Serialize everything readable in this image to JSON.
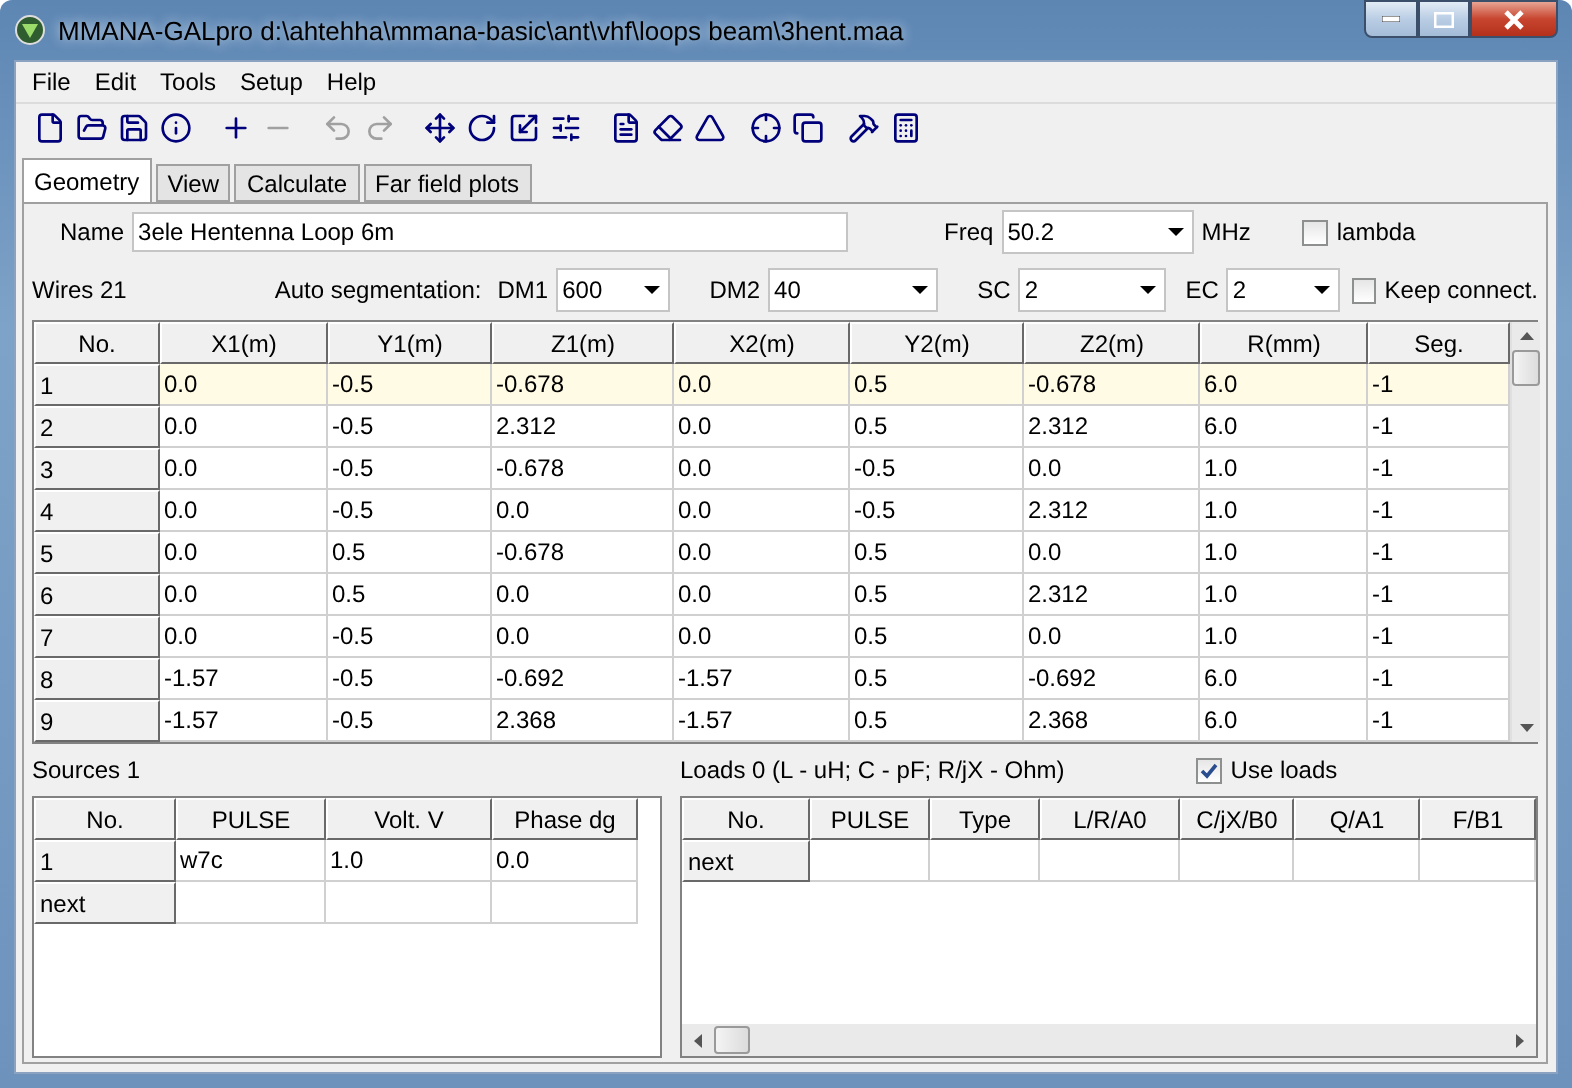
{
  "window": {
    "title": "MMANA-GALpro d:\\ahtehha\\mmana-basic\\ant\\vhf\\loops beam\\3hent.maa"
  },
  "menu": [
    "File",
    "Edit",
    "Tools",
    "Setup",
    "Help"
  ],
  "toolbar": [
    {
      "kind": "new",
      "disabled": false
    },
    {
      "kind": "open",
      "disabled": false
    },
    {
      "kind": "save",
      "disabled": false
    },
    {
      "kind": "info",
      "disabled": false
    },
    {
      "kind": "add",
      "disabled": false
    },
    {
      "kind": "remove",
      "disabled": true
    },
    {
      "kind": "undo",
      "disabled": true
    },
    {
      "kind": "redo",
      "disabled": true
    },
    {
      "kind": "move",
      "disabled": false
    },
    {
      "kind": "rotate",
      "disabled": false
    },
    {
      "kind": "scale",
      "disabled": false
    },
    {
      "kind": "split",
      "disabled": false
    },
    {
      "kind": "document",
      "disabled": false
    },
    {
      "kind": "eraser",
      "disabled": false
    },
    {
      "kind": "triangle",
      "disabled": false
    },
    {
      "kind": "target",
      "disabled": false
    },
    {
      "kind": "copy",
      "disabled": false
    },
    {
      "kind": "tools",
      "disabled": false
    },
    {
      "kind": "calculator",
      "disabled": false
    }
  ],
  "tabs": [
    {
      "label": "Geometry",
      "selected": true
    },
    {
      "label": "View",
      "selected": false
    },
    {
      "label": "Calculate",
      "selected": false
    },
    {
      "label": "Far field plots",
      "selected": false
    }
  ],
  "name": {
    "label": "Name",
    "value": "3ele Hentenna Loop 6m"
  },
  "freq": {
    "label": "Freq",
    "value": "50.2",
    "unit": "MHz"
  },
  "lambda": {
    "label": "lambda",
    "checked": false
  },
  "wires_label": "Wires 21",
  "auto_segmentation": {
    "label": "Auto segmentation:",
    "fields": [
      {
        "label": "DM1",
        "value": "600"
      },
      {
        "label": "DM2",
        "value": "40"
      },
      {
        "label": "SC",
        "value": "2"
      },
      {
        "label": "EC",
        "value": "2"
      }
    ]
  },
  "keep_connect": {
    "label": "Keep connect.",
    "checked": false
  },
  "wires": {
    "columns": [
      "No.",
      "X1(m)",
      "Y1(m)",
      "Z1(m)",
      "X2(m)",
      "Y2(m)",
      "Z2(m)",
      "R(mm)",
      "Seg."
    ],
    "rows": [
      {
        "selected": true,
        "cells": [
          "1",
          "0.0",
          "-0.5",
          "-0.678",
          "0.0",
          "0.5",
          "-0.678",
          "6.0",
          "-1"
        ]
      },
      {
        "selected": false,
        "cells": [
          "2",
          "0.0",
          "-0.5",
          "2.312",
          "0.0",
          "0.5",
          "2.312",
          "6.0",
          "-1"
        ]
      },
      {
        "selected": false,
        "cells": [
          "3",
          "0.0",
          "-0.5",
          "-0.678",
          "0.0",
          "-0.5",
          "0.0",
          "1.0",
          "-1"
        ]
      },
      {
        "selected": false,
        "cells": [
          "4",
          "0.0",
          "-0.5",
          "0.0",
          "0.0",
          "-0.5",
          "2.312",
          "1.0",
          "-1"
        ]
      },
      {
        "selected": false,
        "cells": [
          "5",
          "0.0",
          "0.5",
          "-0.678",
          "0.0",
          "0.5",
          "0.0",
          "1.0",
          "-1"
        ]
      },
      {
        "selected": false,
        "cells": [
          "6",
          "0.0",
          "0.5",
          "0.0",
          "0.0",
          "0.5",
          "2.312",
          "1.0",
          "-1"
        ]
      },
      {
        "selected": false,
        "cells": [
          "7",
          "0.0",
          "-0.5",
          "0.0",
          "0.0",
          "0.5",
          "0.0",
          "1.0",
          "-1"
        ]
      },
      {
        "selected": false,
        "cells": [
          "8",
          "-1.57",
          "-0.5",
          "-0.692",
          "-1.57",
          "0.5",
          "-0.692",
          "6.0",
          "-1"
        ]
      },
      {
        "selected": false,
        "cells": [
          "9",
          "-1.57",
          "-0.5",
          "2.368",
          "-1.57",
          "0.5",
          "2.368",
          "6.0",
          "-1"
        ]
      }
    ]
  },
  "sources": {
    "label": "Sources 1",
    "columns": [
      "No.",
      "PULSE",
      "Volt. V",
      "Phase dg"
    ],
    "rows": [
      {
        "cells": [
          "1",
          "w7c",
          "1.0",
          "0.0"
        ]
      },
      {
        "cells": [
          "next",
          "",
          "",
          ""
        ]
      }
    ]
  },
  "loads": {
    "label": "Loads 0 (L - uH; C - pF; R/jX - Ohm)",
    "use_loads": {
      "label": "Use loads",
      "checked": true
    },
    "columns": [
      "No.",
      "PULSE",
      "Type",
      "L/R/A0",
      "C/jX/B0",
      "Q/A1",
      "F/B1"
    ],
    "rows": [
      {
        "cells": [
          "next",
          "",
          "",
          "",
          "",
          "",
          ""
        ]
      }
    ]
  }
}
